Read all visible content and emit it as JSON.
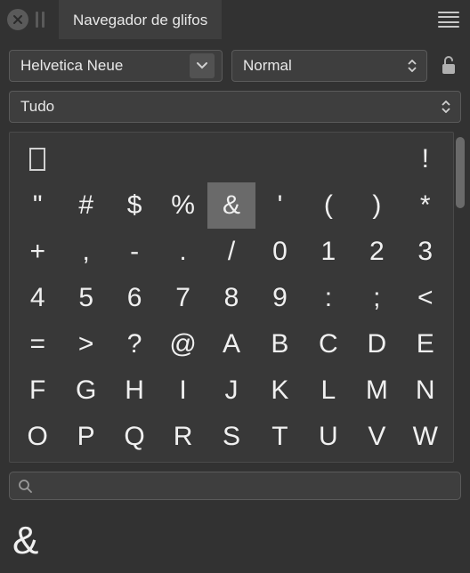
{
  "window": {
    "title": "Navegador de glifos"
  },
  "controls": {
    "font": "Helvetica Neue",
    "style": "Normal",
    "filter": "Tudo"
  },
  "glyphs": [
    "",
    " ",
    " ",
    " ",
    " ",
    " ",
    " ",
    " ",
    "!",
    "\"",
    "#",
    "$",
    "%",
    "&",
    "'",
    "(",
    ")",
    "*",
    "+",
    ",",
    "-",
    ".",
    "/",
    "0",
    "1",
    "2",
    "3",
    "4",
    "5",
    "6",
    "7",
    "8",
    "9",
    ":",
    ";",
    "<",
    "=",
    ">",
    "?",
    "@",
    "A",
    "B",
    "C",
    "D",
    "E",
    "F",
    "G",
    "H",
    "I",
    "J",
    "K",
    "L",
    "M",
    "N",
    "O",
    "P",
    "Q",
    "R",
    "S",
    "T",
    "U",
    "V",
    "W"
  ],
  "selected_index": 13,
  "search": {
    "value": "",
    "placeholder": ""
  },
  "preview": "&"
}
